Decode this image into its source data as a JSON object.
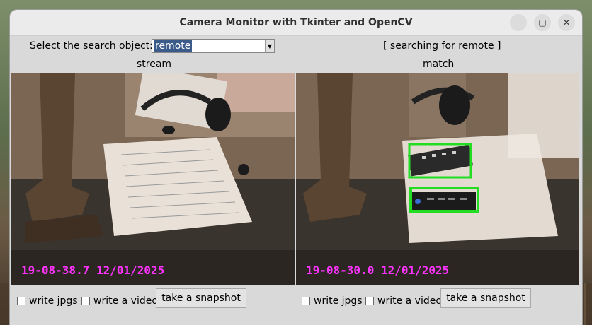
{
  "window": {
    "title": "Camera Monitor with Tkinter and OpenCV",
    "minimize_icon": "minimize-icon",
    "maximize_icon": "maximize-icon",
    "close_icon": "close-icon"
  },
  "search": {
    "label": "Select the search object:",
    "value": "remote",
    "status": "[ searching for remote ]"
  },
  "stream_panel": {
    "label": "stream",
    "overlay": "19-08-38.7   12/01/2025",
    "write_jpgs": "write jpgs",
    "write_video": "write a video",
    "snapshot": "take a snapshot"
  },
  "match_panel": {
    "label": "match",
    "overlay": "19-08-30.0   12/01/2025",
    "write_jpgs": "write jpgs",
    "write_video": "write a video",
    "snapshot": "take a snapshot"
  },
  "colors": {
    "overlay_text": "#ff33ff",
    "detection_box": "#22dd22"
  }
}
